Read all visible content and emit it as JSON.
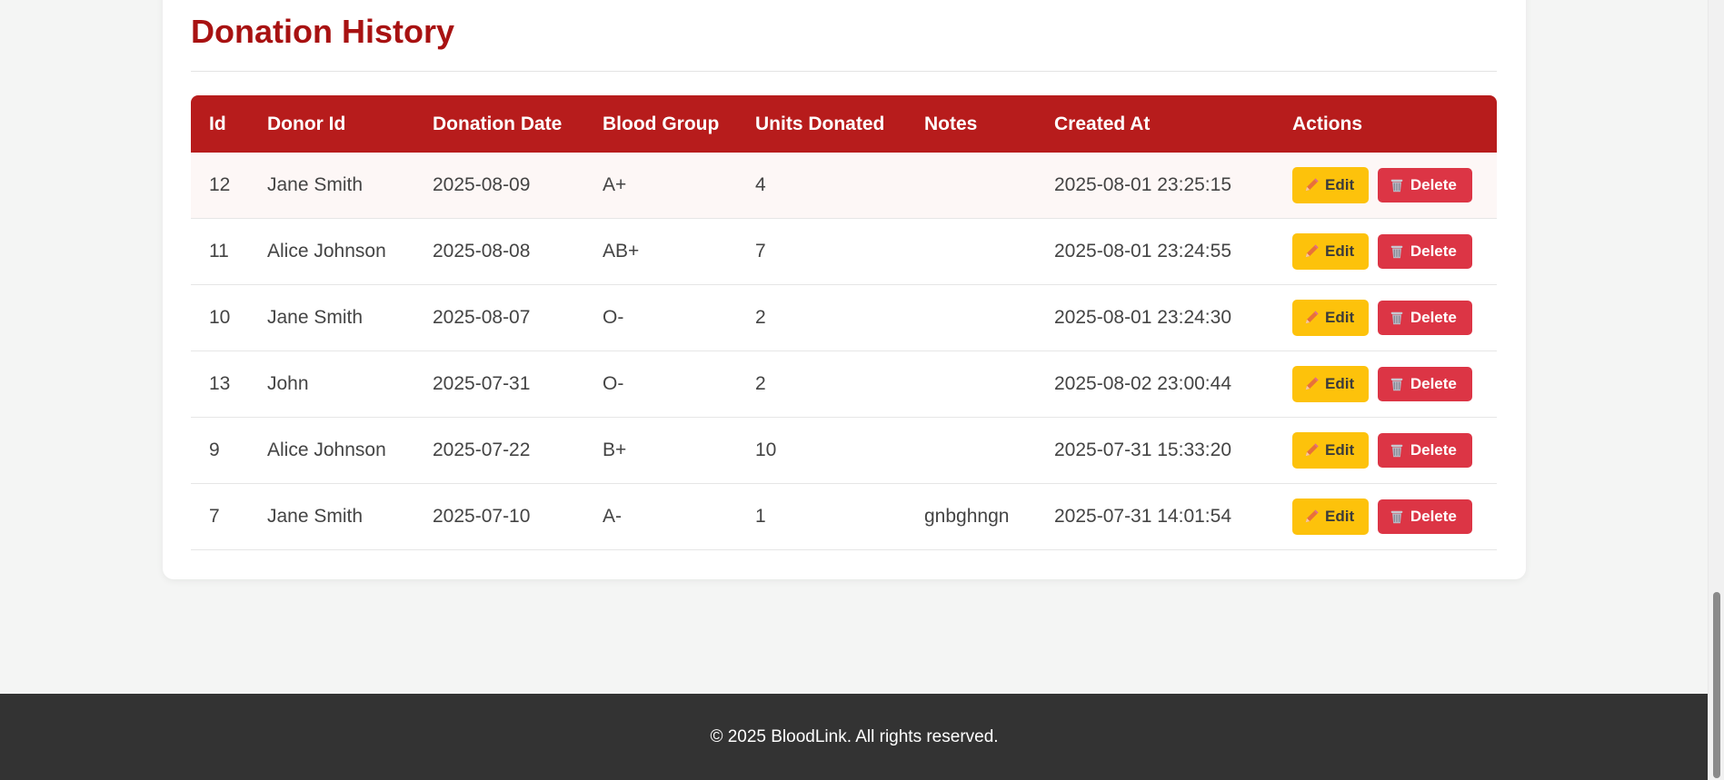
{
  "section": {
    "title": "Donation History"
  },
  "table": {
    "headers": [
      "Id",
      "Donor Id",
      "Donation Date",
      "Blood Group",
      "Units Donated",
      "Notes",
      "Created At",
      "Actions"
    ],
    "rows": [
      {
        "id": "12",
        "donor": "Jane Smith",
        "date": "2025-08-09",
        "group": "A+",
        "units": "4",
        "notes": "",
        "created": "2025-08-01 23:25:15"
      },
      {
        "id": "11",
        "donor": "Alice Johnson",
        "date": "2025-08-08",
        "group": "AB+",
        "units": "7",
        "notes": "",
        "created": "2025-08-01 23:24:55"
      },
      {
        "id": "10",
        "donor": "Jane Smith",
        "date": "2025-08-07",
        "group": "O-",
        "units": "2",
        "notes": "",
        "created": "2025-08-01 23:24:30"
      },
      {
        "id": "13",
        "donor": "John",
        "date": "2025-07-31",
        "group": "O-",
        "units": "2",
        "notes": "",
        "created": "2025-08-02 23:00:44"
      },
      {
        "id": "9",
        "donor": "Alice Johnson",
        "date": "2025-07-22",
        "group": "B+",
        "units": "10",
        "notes": "",
        "created": "2025-07-31 15:33:20"
      },
      {
        "id": "7",
        "donor": "Jane Smith",
        "date": "2025-07-10",
        "group": "A-",
        "units": "1",
        "notes": "gnbghngn",
        "created": "2025-07-31 14:01:54"
      }
    ],
    "edit_label": "Edit",
    "delete_label": "Delete",
    "edit_icon": "pencil-icon",
    "delete_icon": "wastebasket-icon"
  },
  "footer": {
    "text": "© 2025 BloodLink. All rights reserved."
  },
  "colors": {
    "brand": "#b71c1c",
    "title": "#a81212",
    "edit": "#fdc20b",
    "delete": "#dc3545",
    "footer": "#333333"
  }
}
